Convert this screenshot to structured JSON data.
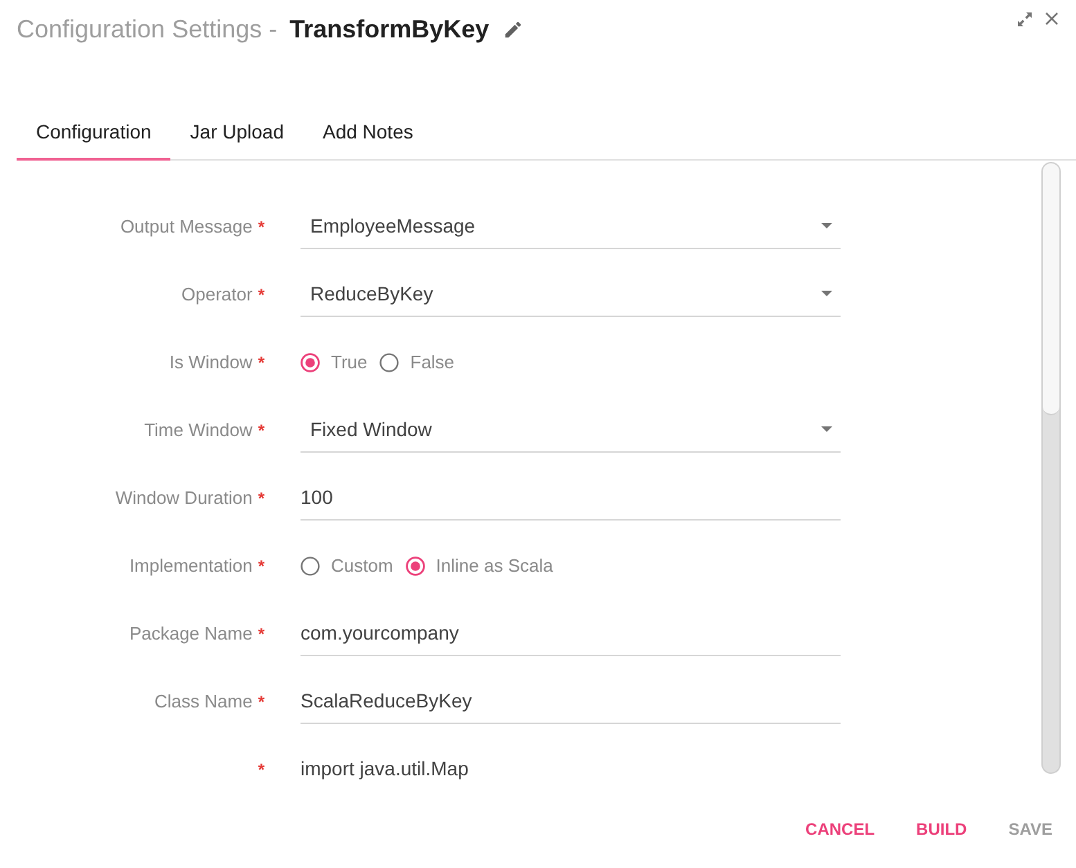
{
  "dialog": {
    "title": "Configuration Settings -",
    "name": "TransformByKey"
  },
  "tabs": [
    {
      "label": "Configuration",
      "selected": true
    },
    {
      "label": "Jar Upload",
      "selected": false
    },
    {
      "label": "Add Notes",
      "selected": false
    }
  ],
  "fields": [
    {
      "kind": "select",
      "label": "Output Message",
      "required_mark": "*",
      "value": "EmployeeMessage"
    },
    {
      "kind": "select",
      "label": "Operator",
      "required_mark": "*",
      "value": "ReduceByKey"
    },
    {
      "kind": "radio",
      "label": "Is Window",
      "required_mark": "*",
      "options": [
        {
          "label": "True",
          "selected": true
        },
        {
          "label": "False",
          "selected": false
        }
      ]
    },
    {
      "kind": "select",
      "label": "Time Window",
      "required_mark": "*",
      "value": "Fixed Window"
    },
    {
      "kind": "text",
      "label": "Window Duration",
      "required_mark": "*",
      "value": "100"
    },
    {
      "kind": "radio",
      "label": "Implementation",
      "required_mark": "*",
      "options": [
        {
          "label": "Custom",
          "selected": false
        },
        {
          "label": "Inline as Scala",
          "selected": true
        }
      ]
    },
    {
      "kind": "text",
      "label": "Package Name",
      "required_mark": "*",
      "value": "com.yourcompany"
    },
    {
      "kind": "text",
      "label": "Class Name",
      "required_mark": "*",
      "value": "ScalaReduceByKey"
    },
    {
      "kind": "code",
      "required_mark": "*",
      "value": "import java.util.Map"
    }
  ],
  "buttons": [
    {
      "label": "CANCEL",
      "disabled": false
    },
    {
      "label": "BUILD",
      "disabled": false
    },
    {
      "label": "SAVE",
      "disabled": true
    }
  ]
}
